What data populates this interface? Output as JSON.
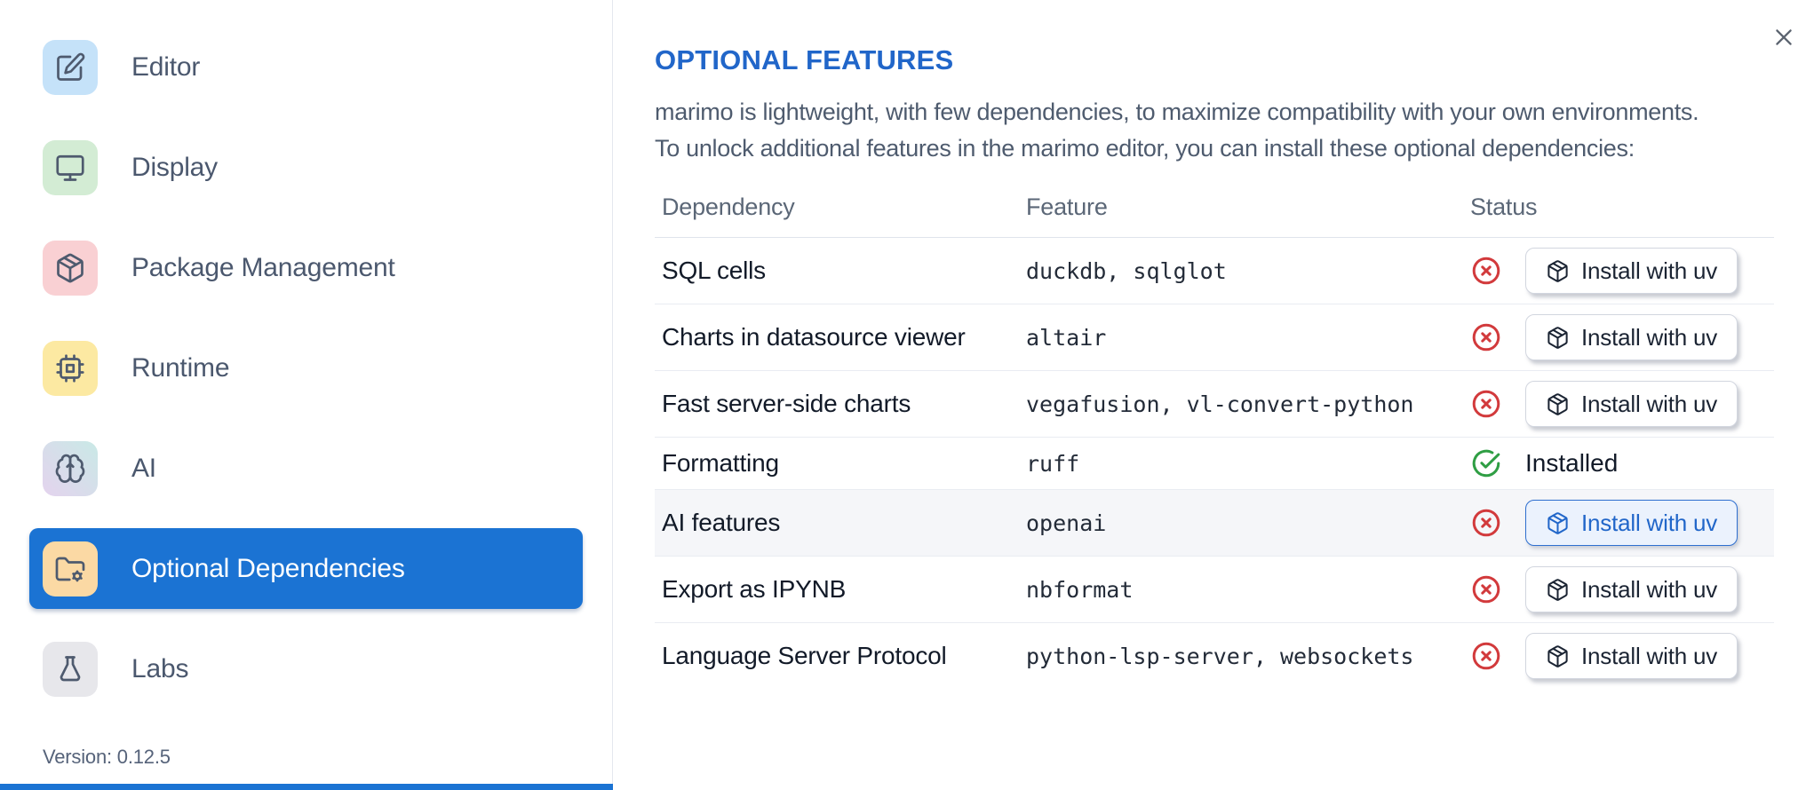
{
  "sidebar": {
    "selected_color": "#1b73d3",
    "items": [
      {
        "label": "Editor",
        "icon": "edit",
        "tile": {
          "colors": [
            "#c5e2f9"
          ]
        },
        "selected": false
      },
      {
        "label": "Display",
        "icon": "monitor",
        "tile": {
          "colors": [
            "#d3ecd4"
          ]
        },
        "selected": false
      },
      {
        "label": "Package Management",
        "icon": "package",
        "tile": {
          "colors": [
            "#f9d0d3"
          ]
        },
        "selected": false
      },
      {
        "label": "Runtime",
        "icon": "cpu",
        "tile": {
          "colors": [
            "#fce9a2"
          ]
        },
        "selected": false
      },
      {
        "label": "AI",
        "icon": "brain",
        "tile": {
          "gradient": true,
          "colors": [
            "#e4d3ee",
            "#c9e9e6"
          ]
        },
        "selected": false
      },
      {
        "label": "Optional Dependencies",
        "icon": "folder-cog",
        "tile": {
          "colors": [
            "#fbd9a4"
          ]
        },
        "selected": true
      },
      {
        "label": "Labs",
        "icon": "flask",
        "tile": {
          "colors": [
            "#e7e7eb"
          ]
        },
        "selected": false
      }
    ],
    "version_label": "Version: 0.12.5"
  },
  "panel": {
    "title": "OPTIONAL FEATURES",
    "title_color": "#2166c9",
    "description_line1": "marimo is lightweight, with few dependencies, to maximize compatibility with your own environments.",
    "description_line2": "To unlock additional features in the marimo editor, you can install these optional dependencies:"
  },
  "table": {
    "headers": [
      "Dependency",
      "Feature",
      "Status"
    ],
    "installed_label": "Installed",
    "status_colors": {
      "error": "#d23a3c",
      "success": "#2f9e44"
    },
    "rows": [
      {
        "dependency": "SQL cells",
        "feature": "duckdb, sqlglot",
        "status": "not_installed",
        "button_label": "Install with uv",
        "button_variant": "default"
      },
      {
        "dependency": "Charts in datasource viewer",
        "feature": "altair",
        "status": "not_installed",
        "button_label": "Install with uv",
        "button_variant": "default"
      },
      {
        "dependency": "Fast server-side charts",
        "feature": "vegafusion, vl-convert-python",
        "status": "not_installed",
        "button_label": "Install with uv",
        "button_variant": "default"
      },
      {
        "dependency": "Formatting",
        "feature": "ruff",
        "status": "installed"
      },
      {
        "dependency": "AI features",
        "feature": "openai",
        "status": "not_installed",
        "button_label": "Install with uv",
        "button_variant": "highlighted",
        "row_highlight": true
      },
      {
        "dependency": "Export as IPYNB",
        "feature": "nbformat",
        "status": "not_installed",
        "button_label": "Install with uv",
        "button_variant": "default"
      },
      {
        "dependency": "Language Server Protocol",
        "feature": "python-lsp-server, websockets",
        "status": "not_installed",
        "button_label": "Install with uv",
        "button_variant": "default"
      }
    ]
  }
}
